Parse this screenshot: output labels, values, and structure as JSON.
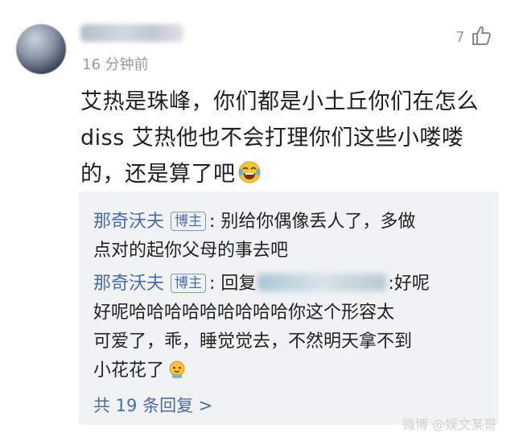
{
  "comment": {
    "time": "16 分钟前",
    "like_count": "7",
    "lines": [
      "艾热是珠峰，你们都是小土丘你们在怎么",
      "diss 艾热他也不会打理你们这些小喽喽",
      "的，还是算了吧"
    ]
  },
  "replies": [
    {
      "author": "那奇沃夫",
      "badge": "博主",
      "line1": ": 别给你偶像丢人了，多做",
      "line2": "点对的起你父母的事去吧"
    },
    {
      "author": "那奇沃夫",
      "badge": "博主",
      "prefix": ": 回复",
      "suffix": ":好呢",
      "line2": "好呢哈哈哈哈哈哈哈哈哈你这个形容太",
      "line3": "可爱了，乖，睡觉觉去，不然明天拿不到",
      "line4": "小花花了"
    }
  ],
  "more_replies": "共 19 条回复 >",
  "watermark": "微博 @娱文某哥",
  "colors": {
    "link_blue": "#4a6da8",
    "gray_text": "#9a9a9a",
    "reply_bg": "#f1f2f4"
  },
  "icons": [
    "thumbs-up-icon",
    "laughing-crying-emoji",
    "cute-emoji"
  ]
}
